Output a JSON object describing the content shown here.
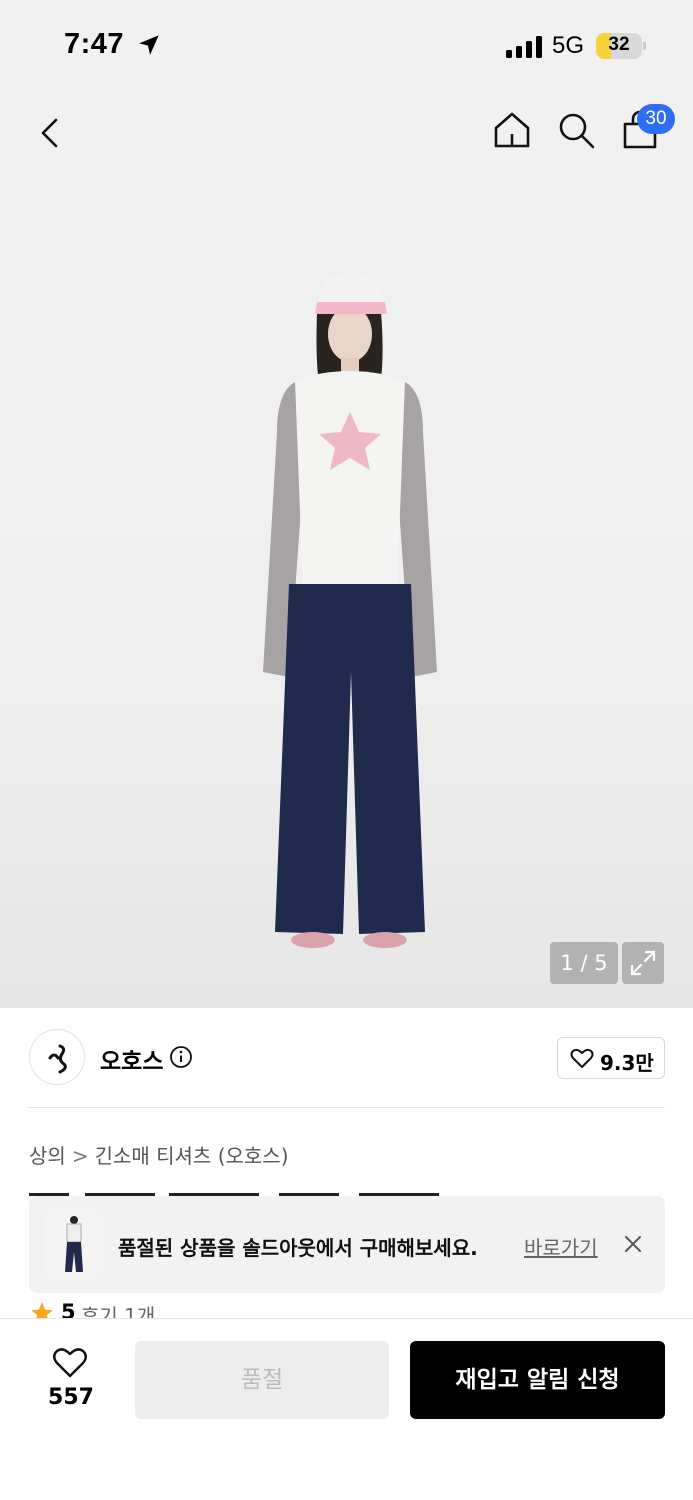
{
  "status_bar": {
    "time": "7:47",
    "network": "5G",
    "battery": "32",
    "battery_level": 0.32
  },
  "nav": {
    "cart_count": "30"
  },
  "hero": {
    "page_indicator": "1 / 5"
  },
  "brand": {
    "name": "오호스",
    "likes": "9.3만"
  },
  "breadcrumb": {
    "items": [
      "상의",
      "긴소매 티셔츠 (오호스)"
    ],
    "separator": ">"
  },
  "toast": {
    "message": "품절된 상품을 솔드아웃에서 구매해보세요.",
    "link_label": "바로가기"
  },
  "rating": {
    "score": "5",
    "reviews": "후기 1개"
  },
  "bottom_bar": {
    "like_count": "557",
    "soldout_label": "품절",
    "restock_label": "재입고 알림 신청"
  },
  "colors": {
    "accent_badge": "#2f6df6",
    "battery_fill": "#f4d23c",
    "cta_background": "#000000",
    "star": "#f5a623"
  }
}
